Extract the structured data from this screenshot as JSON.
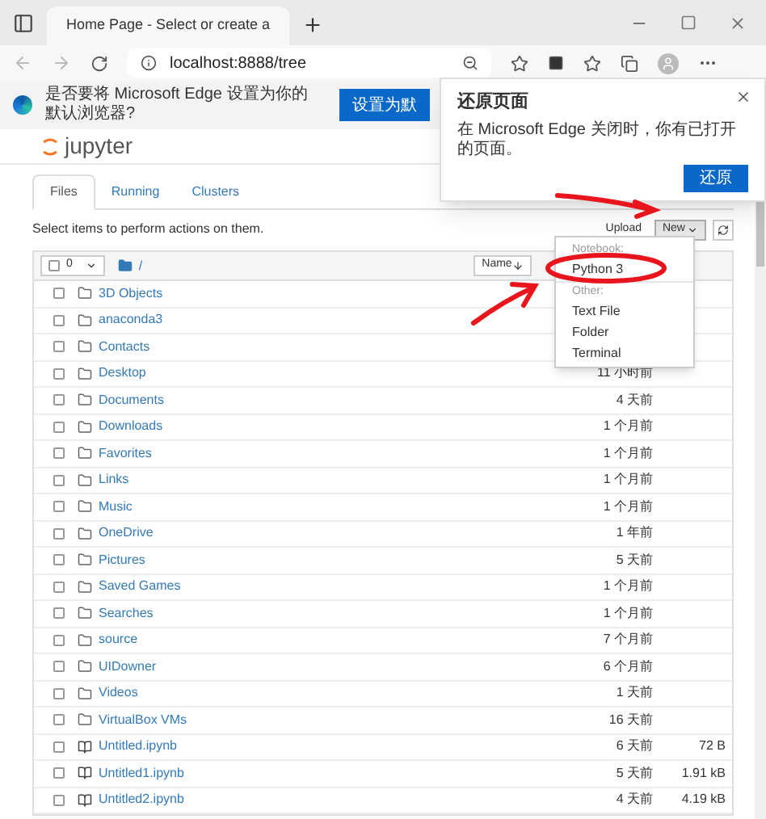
{
  "browser": {
    "tab_title": "Home Page - Select or create a",
    "address": "localhost:8888/tree"
  },
  "infobar": {
    "message": "是否要将 Microsoft Edge 设置为你的默认浏览器?",
    "button": "设置为默"
  },
  "restore_popup": {
    "title": "还原页面",
    "message": "在 Microsoft Edge 关闭时，你有已打开的页面。",
    "button": "还原"
  },
  "jupyter": {
    "logo": "jupyter",
    "tabs": [
      {
        "label": "Files",
        "selected": true
      },
      {
        "label": "Running",
        "selected": false
      },
      {
        "label": "Clusters",
        "selected": false
      }
    ],
    "hint": "Select items to perform actions on them.",
    "upload": "Upload",
    "new": "New",
    "selected_count": "0",
    "path": "/",
    "sort_column": "Name"
  },
  "new_menu": {
    "sections": [
      {
        "header": "Notebook:",
        "items": [
          "Python 3"
        ]
      },
      {
        "header": "Other:",
        "items": [
          "Text File",
          "Folder",
          "Terminal"
        ]
      }
    ]
  },
  "files": [
    {
      "kind": "folder",
      "name": "3D Objects",
      "checked": false
    },
    {
      "kind": "folder",
      "name": "anaconda3",
      "checked": false
    },
    {
      "kind": "folder",
      "name": "Contacts",
      "checked": false
    },
    {
      "kind": "folder",
      "name": "Desktop",
      "modified": "11 小时前",
      "checked": false
    },
    {
      "kind": "folder",
      "name": "Documents",
      "modified": "4 天前",
      "checked": false
    },
    {
      "kind": "folder",
      "name": "Downloads",
      "modified": "1 个月前",
      "checked": false
    },
    {
      "kind": "folder",
      "name": "Favorites",
      "modified": "1 个月前",
      "checked": false
    },
    {
      "kind": "folder",
      "name": "Links",
      "modified": "1 个月前",
      "checked": false
    },
    {
      "kind": "folder",
      "name": "Music",
      "modified": "1 个月前",
      "checked": false
    },
    {
      "kind": "folder",
      "name": "OneDrive",
      "modified": "1 年前",
      "checked": false
    },
    {
      "kind": "folder",
      "name": "Pictures",
      "modified": "5 天前",
      "checked": false
    },
    {
      "kind": "folder",
      "name": "Saved Games",
      "modified": "1 个月前",
      "checked": false
    },
    {
      "kind": "folder",
      "name": "Searches",
      "modified": "1 个月前",
      "checked": false
    },
    {
      "kind": "folder",
      "name": "source",
      "modified": "7 个月前",
      "checked": false
    },
    {
      "kind": "folder",
      "name": "UIDowner",
      "modified": "6 个月前",
      "checked": false
    },
    {
      "kind": "folder",
      "name": "Videos",
      "modified": "1 天前",
      "checked": false
    },
    {
      "kind": "folder",
      "name": "VirtualBox VMs",
      "modified": "16 天前",
      "checked": false
    },
    {
      "kind": "notebook",
      "name": "Untitled.ipynb",
      "modified": "6 天前",
      "size": "72 B",
      "checked": false
    },
    {
      "kind": "notebook",
      "name": "Untitled1.ipynb",
      "modified": "5 天前",
      "size": "1.91 kB",
      "checked": false
    },
    {
      "kind": "notebook",
      "name": "Untitled2.ipynb",
      "modified": "4 天前",
      "size": "4.19 kB",
      "checked": false
    }
  ]
}
